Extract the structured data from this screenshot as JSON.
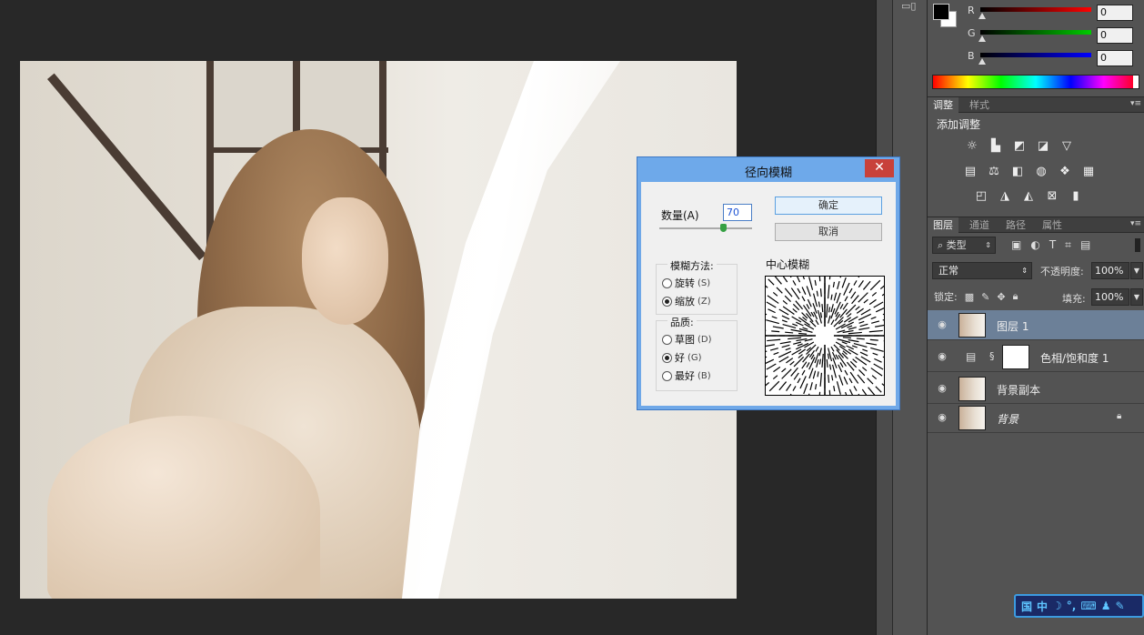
{
  "color_panel": {
    "channels": [
      {
        "label": "R",
        "value": "0",
        "color": "#e01e1e"
      },
      {
        "label": "G",
        "value": "0",
        "color": "#1ec41e"
      },
      {
        "label": "B",
        "value": "0",
        "color": "#1e1ee0"
      }
    ]
  },
  "adjust_panel": {
    "tabs": [
      "调整",
      "样式"
    ],
    "title": "添加调整",
    "row1": [
      "brightness-icon",
      "levels-icon",
      "curves-icon",
      "exposure-icon",
      "vibrance-icon"
    ],
    "row2": [
      "hue-saturation-icon",
      "color-balance-icon",
      "black-white-icon",
      "photo-filter-icon",
      "channel-mixer-icon",
      "color-lookup-icon"
    ],
    "row3": [
      "invert-icon",
      "posterize-icon",
      "threshold-icon",
      "selective-color-icon",
      "gradient-map-icon"
    ]
  },
  "layers_panel": {
    "tabs": [
      "图层",
      "通道",
      "路径",
      "属性"
    ],
    "filter_label": "类型",
    "blend_mode": "正常",
    "opacity_label": "不透明度:",
    "opacity_value": "100%",
    "lock_label": "锁定:",
    "fill_label": "填充:",
    "fill_value": "100%",
    "layers": [
      {
        "name": "图层 1",
        "selected": true
      },
      {
        "name": "色相/饱和度 1",
        "adjustment": true
      },
      {
        "name": "背景副本"
      },
      {
        "name": "背景",
        "italic": true,
        "locked": true
      }
    ]
  },
  "dialog": {
    "title": "径向模糊",
    "close_label": "✕",
    "amount_label": "数量(A)",
    "amount_value": "70",
    "amount_fraction": 0.7,
    "ok_label": "确定",
    "cancel_label": "取消",
    "method_title": "模糊方法:",
    "methods": [
      {
        "label": "旋转",
        "key": "(S)",
        "checked": false
      },
      {
        "label": "缩放",
        "key": "(Z)",
        "checked": true
      }
    ],
    "quality_title": "品质:",
    "qualities": [
      {
        "label": "草图",
        "key": "(D)",
        "checked": false
      },
      {
        "label": "好",
        "key": "(G)",
        "checked": true
      },
      {
        "label": "最好",
        "key": "(B)",
        "checked": false
      }
    ],
    "center_label": "中心模糊"
  },
  "ime": {
    "items": [
      "国",
      "中",
      "☽",
      "°,",
      "⌨",
      "♟",
      "✎"
    ]
  }
}
